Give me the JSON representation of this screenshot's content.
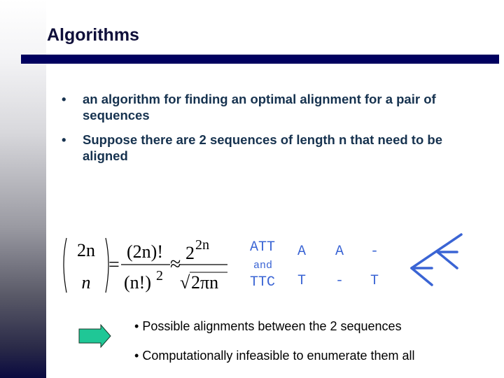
{
  "slide": {
    "title": "Algorithms",
    "bullets": [
      {
        "marker": "•",
        "text": "an algorithm for finding an optimal alignment for a pair of sequences"
      },
      {
        "marker": "•",
        "text": "Suppose there are 2 sequences of length n that need to be aligned"
      }
    ],
    "formula": {
      "binom_top": "2n",
      "binom_bottom": "n",
      "equals": "=",
      "frac_num": "(2n)!",
      "frac_den_base": "(n!)",
      "frac_den_exp": "2",
      "approx": "≈",
      "approx_num_base": "2",
      "approx_num_exp": "2n",
      "approx_den": "2πn",
      "sqrt": "√"
    },
    "alignment": {
      "seq1": "ATT",
      "connector": "and",
      "seq2": "TTC",
      "columns": [
        {
          "top": "A",
          "bottom": "T"
        },
        {
          "top": "A",
          "bottom": "-"
        },
        {
          "top": "-",
          "bottom": "T"
        }
      ],
      "color": "#3a64d4"
    },
    "sub_bullets": [
      {
        "marker": "•",
        "text": "Possible alignments between the 2 sequences"
      },
      {
        "marker": "•",
        "text": "Computationally infeasible to enumerate them all"
      }
    ],
    "icons": {
      "arrow": "right-arrow-icon",
      "tree": "branching-tree-icon"
    },
    "colors": {
      "title_rule": "#00005f",
      "arrow_fill": "#1fc796",
      "bullet_text": "#16324f"
    }
  }
}
